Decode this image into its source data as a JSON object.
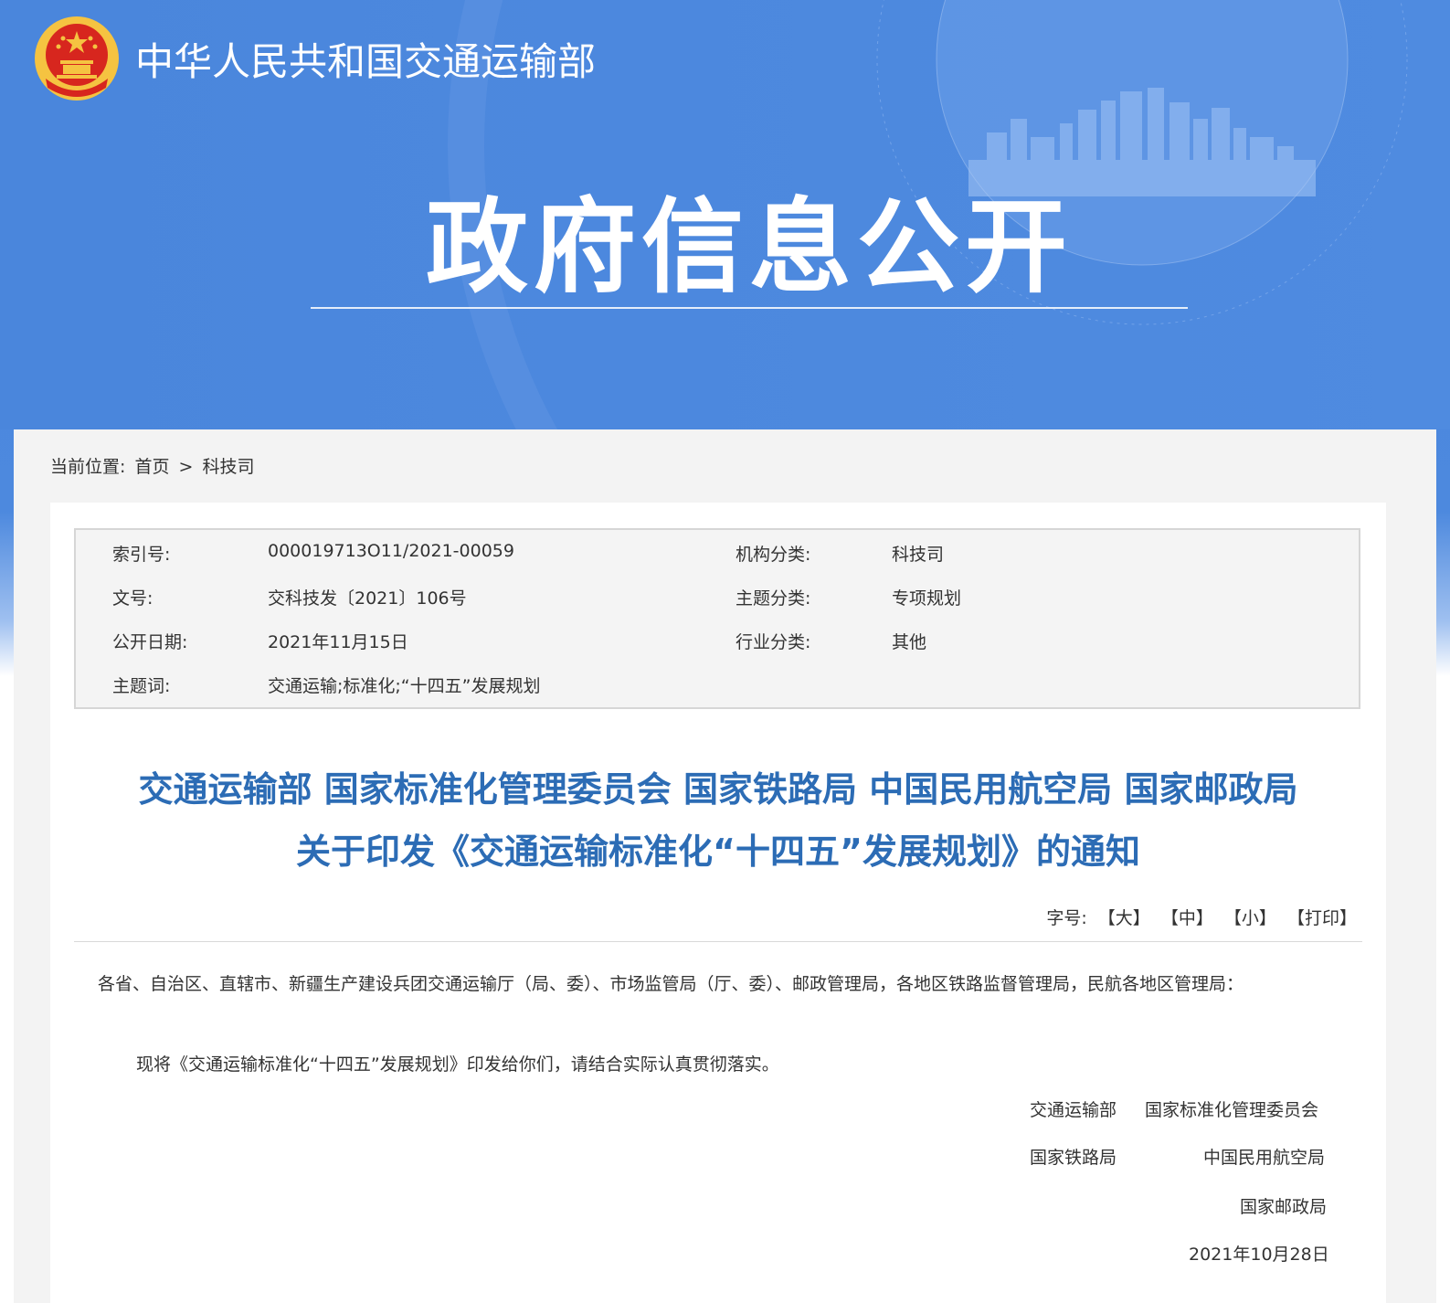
{
  "header": {
    "site_name": "中华人民共和国交通运输部",
    "banner_title": "政府信息公开"
  },
  "breadcrumb": {
    "label": "当前位置:",
    "home": "首页",
    "separator": ">",
    "current": "科技司"
  },
  "meta": {
    "index_label": "索引号:",
    "index_value": "000019713O11/2021-00059",
    "org_label": "机构分类:",
    "org_value": "科技司",
    "docno_label": "文号:",
    "docno_value": "交科技发〔2021〕106号",
    "topic_label": "主题分类:",
    "topic_value": "专项规划",
    "date_label": "公开日期:",
    "date_value": "2021年11月15日",
    "industry_label": "行业分类:",
    "industry_value": "其他",
    "keywords_label": "主题词:",
    "keywords_value": "交通运输;标准化;“十四五”发展规划"
  },
  "document": {
    "title_line1": "交通运输部 国家标准化管理委员会 国家铁路局 中国民用航空局 国家邮政局",
    "title_line2": "关于印发《交通运输标准化“十四五”发展规划》的通知",
    "addressee": "各省、自治区、直辖市、新疆生产建设兵团交通运输厅（局、委）、市场监管局（厅、委）、邮政管理局，各地区铁路监督管理局，民航各地区管理局：",
    "paragraph": "现将《交通运输标准化“十四五”发展规划》印发给你们，请结合实际认真贯彻落实。",
    "signers": {
      "s1": "交通运输部",
      "s2": "国家标准化管理委员会",
      "s3": "国家铁路局",
      "s4": "中国民用航空局",
      "s5": "国家邮政局"
    },
    "date": "2021年10月28日"
  },
  "font_size_bar": {
    "label": "字号:",
    "large": "【大】",
    "medium": "【中】",
    "small": "【小】",
    "print": "【打印】"
  },
  "colors": {
    "banner_blue": "#4a86dc",
    "title_blue": "#2c6cb5",
    "emblem_red": "#d7261e",
    "emblem_gold": "#f5c341"
  }
}
